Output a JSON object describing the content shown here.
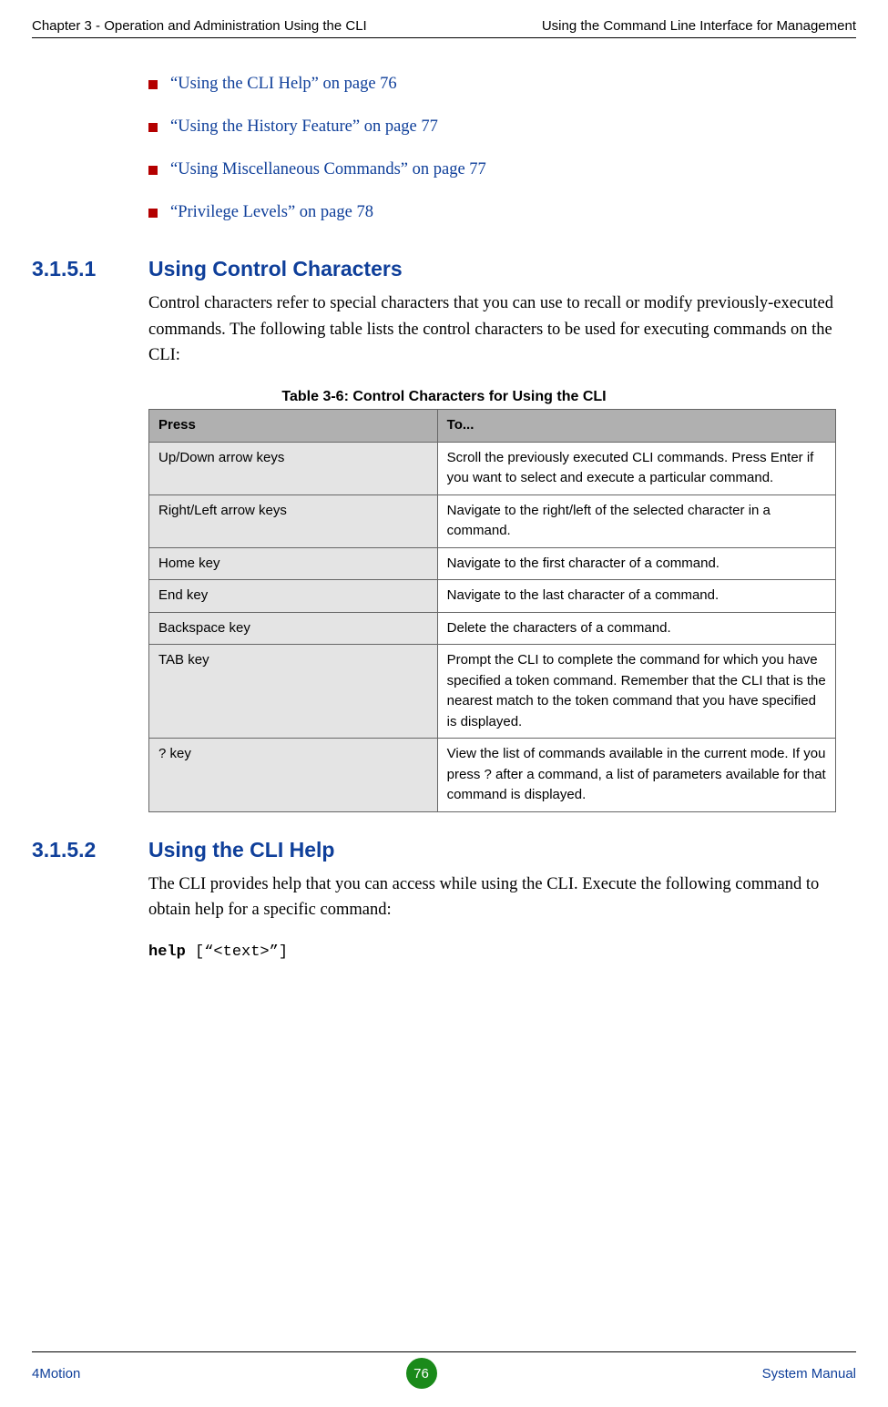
{
  "header": {
    "left": "Chapter 3 - Operation and Administration Using the CLI",
    "right": "Using the Command Line Interface for Management"
  },
  "bullets": {
    "b1": "“Using the CLI Help” on page 76",
    "b2": "“Using the History Feature” on page 77",
    "b3": "“Using Miscellaneous Commands” on page 77",
    "b4": "“Privilege Levels” on page 78"
  },
  "sections": {
    "s1": {
      "num": "3.1.5.1",
      "title": "Using Control Characters"
    },
    "s2": {
      "num": "3.1.5.2",
      "title": "Using the CLI Help"
    }
  },
  "paragraphs": {
    "p1": "Control characters refer to special characters that you can use to recall or modify previously-executed commands. The following table lists the control characters to be used for executing commands on the CLI:",
    "p2": "The CLI provides help that you can access while using the CLI. Execute the following command to obtain help for a specific command:"
  },
  "table": {
    "caption": "Table 3-6: Control Characters for Using the CLI",
    "head": {
      "press": "Press",
      "to": "To..."
    },
    "rows": {
      "r1": {
        "press": "Up/Down arrow keys",
        "to": "Scroll the previously executed CLI commands. Press Enter if you want to select and execute a particular command."
      },
      "r2": {
        "press": "Right/Left arrow keys",
        "to": "Navigate to the right/left of the selected character in a command."
      },
      "r3": {
        "press": "Home key",
        "to": "Navigate to the first character of a command."
      },
      "r4": {
        "press": "End key",
        "to": "Navigate to the last character of a command."
      },
      "r5": {
        "press": "Backspace key",
        "to": "Delete the characters of a command."
      },
      "r6": {
        "press": "TAB key",
        "to": "Prompt the CLI to complete the command for which you have specified a token command. Remember that the CLI that is the nearest match to the token command that you have specified is displayed."
      },
      "r7": {
        "press": "? key",
        "to": "View the list of commands available in the current mode. If you press ? after a command, a list of parameters available for that command is displayed."
      }
    }
  },
  "code": {
    "cmd": "help",
    "arg": " [“<text>”]"
  },
  "footer": {
    "left": "4Motion",
    "page": "76",
    "right": "System Manual"
  }
}
